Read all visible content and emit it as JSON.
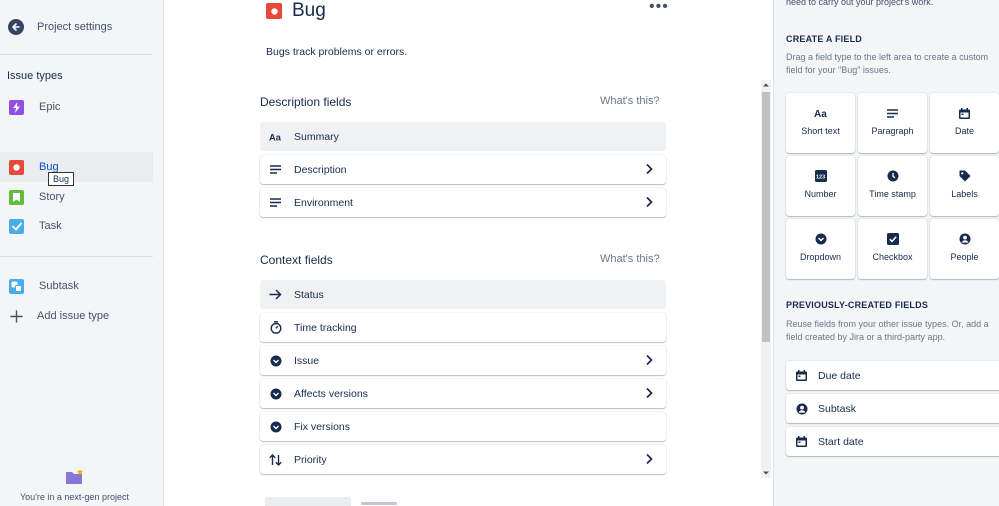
{
  "sidebar": {
    "back_label": "Project settings",
    "heading": "Issue types",
    "items": [
      {
        "label": "Epic",
        "icon": "epic-icon",
        "color": "#904ee2"
      },
      {
        "label": "Bug",
        "icon": "bug-icon",
        "color": "#e5493a",
        "active": true
      },
      {
        "label": "Story",
        "icon": "story-icon",
        "color": "#63ba3c"
      },
      {
        "label": "Task",
        "icon": "task-icon",
        "color": "#4bade8"
      },
      {
        "label": "Subtask",
        "icon": "subtask-icon",
        "color": "#4bade8"
      }
    ],
    "add_label": "Add issue type",
    "tooltip": "Bug",
    "footnote": "You're in a next-gen project"
  },
  "main": {
    "title": "Bug",
    "description": "Bugs track problems or errors.",
    "more_label": "•••",
    "description_fields": {
      "title": "Description fields",
      "help": "What's this?",
      "rows": [
        {
          "label": "Summary",
          "icon": "text-icon",
          "chevron": false
        },
        {
          "label": "Description",
          "icon": "paragraph-icon",
          "chevron": true
        },
        {
          "label": "Environment",
          "icon": "paragraph-icon",
          "chevron": true
        }
      ]
    },
    "context_fields": {
      "title": "Context fields",
      "help": "What's this?",
      "rows": [
        {
          "label": "Status",
          "icon": "arrow-right-icon",
          "chevron": false
        },
        {
          "label": "Time tracking",
          "icon": "stopwatch-icon",
          "chevron": false
        },
        {
          "label": "Issue",
          "icon": "dropdown-icon",
          "chevron": true
        },
        {
          "label": "Affects versions",
          "icon": "dropdown-icon",
          "chevron": true
        },
        {
          "label": "Fix versions",
          "icon": "dropdown-icon",
          "chevron": false
        },
        {
          "label": "Priority",
          "icon": "priority-icon",
          "chevron": true
        }
      ]
    }
  },
  "right_panel": {
    "top_note": "need to carry out your project's work.",
    "create_heading": "CREATE A FIELD",
    "create_text": "Drag a field type to the left area to create a custom field for your \"Bug\" issues.",
    "field_types": [
      {
        "label": "Short text",
        "icon": "text-icon"
      },
      {
        "label": "Paragraph",
        "icon": "paragraph-icon"
      },
      {
        "label": "Date",
        "icon": "calendar-icon"
      },
      {
        "label": "Number",
        "icon": "number-icon"
      },
      {
        "label": "Time stamp",
        "icon": "clock-icon"
      },
      {
        "label": "Labels",
        "icon": "label-icon"
      },
      {
        "label": "Dropdown",
        "icon": "dropdown-icon"
      },
      {
        "label": "Checkbox",
        "icon": "checkbox-icon"
      },
      {
        "label": "People",
        "icon": "person-icon"
      }
    ],
    "prev_heading": "PREVIOUSLY-CREATED FIELDS",
    "prev_text": "Reuse fields from your other issue types. Or, add a field created by Jira or a third-party app.",
    "prev_fields": [
      {
        "label": "Due date",
        "icon": "calendar-icon"
      },
      {
        "label": "Subtask",
        "icon": "person-icon"
      },
      {
        "label": "Start date",
        "icon": "calendar-icon"
      }
    ]
  }
}
